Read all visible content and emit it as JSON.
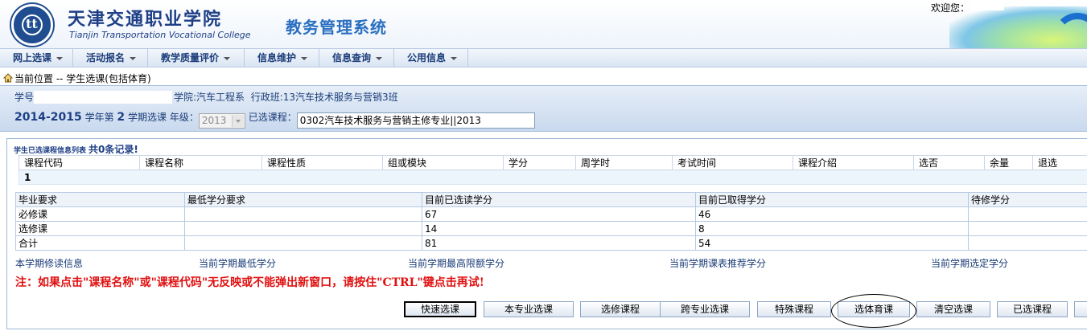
{
  "header": {
    "college_cn": "天津交通职业学院",
    "college_en": "Tianjin Transportation Vocational College",
    "system_title": "教务管理系统",
    "welcome": "欢迎您："
  },
  "nav": {
    "items": [
      {
        "label": "网上选课"
      },
      {
        "label": "活动报名"
      },
      {
        "label": "教学质量评价"
      },
      {
        "label": "信息维护"
      },
      {
        "label": "信息查询"
      },
      {
        "label": "公用信息"
      }
    ]
  },
  "location": {
    "prefix": "当前位置",
    "path": " -- 学生选课(包括体育)"
  },
  "student": {
    "id_label": "学号",
    "college": "学院:汽车工程系",
    "class": "行政班:13汽车技术服务与营销3班"
  },
  "term": {
    "year": "2014-2015",
    "year_suffix": "学年第",
    "term_no": "2",
    "term_suffix": "学期选课",
    "grade_label": "年级：",
    "grade_value": "2013",
    "selected_label": "已选课程：",
    "selected_value": "0302汽车技术服务与营销主修专业||2013"
  },
  "course_list": {
    "caption": "学生已选课程信息列表",
    "count_text": "共0条记录!",
    "columns": [
      "课程代码",
      "课程名称",
      "课程性质",
      "组或模块",
      "学分",
      "周学时",
      "考试时间",
      "课程介绍",
      "选否",
      "余量",
      "退选"
    ],
    "page_no": "1"
  },
  "summary": {
    "columns": [
      "毕业要求",
      "最低学分要求",
      "目前已选读学分",
      "目前已取得学分",
      "待修学分"
    ],
    "rows": [
      [
        "必修课",
        "",
        "67",
        "46",
        ""
      ],
      [
        "选修课",
        "",
        "14",
        "8",
        ""
      ],
      [
        "合计",
        "",
        "81",
        "54",
        ""
      ]
    ]
  },
  "footer_labels": [
    "本学期修读信息",
    "当前学期最低学分",
    "当前学期最高限额学分",
    "当前学期课表推荐学分",
    "当前学期选定学分"
  ],
  "notice": "注：如果点击\"课程名称\"或\"课程代码\"无反映或不能弹出新窗口，请按住\"CTRL\"键点击再试!",
  "buttons": [
    "快速选课",
    "本专业选课",
    "选修课程",
    "跨专业选课",
    "特殊课程",
    "选体育课",
    "清空选课",
    "已选课程"
  ],
  "colors": {
    "brand_blue": "#1e3f86",
    "notice_red": "#e01010"
  }
}
